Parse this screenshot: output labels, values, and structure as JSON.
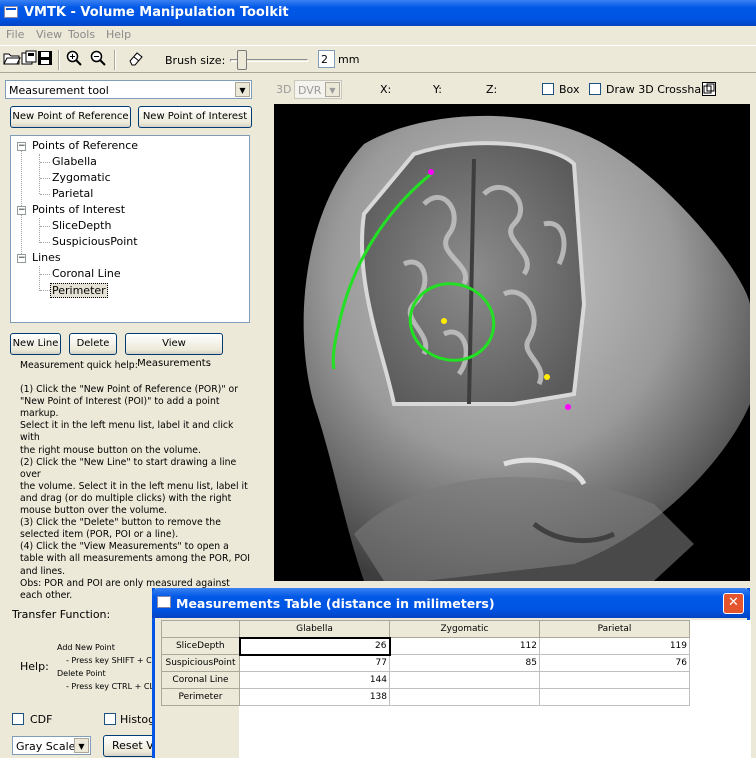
{
  "app": {
    "title": "VMTK - Volume Manipulation Toolkit"
  },
  "menu": [
    "File",
    "View",
    "Tools",
    "Help"
  ],
  "toolbar": {
    "brush_label": "Brush size:",
    "brush_value": "2",
    "brush_unit": "mm",
    "brush_slider_level": 0.1
  },
  "tool_select": {
    "selected": "Measurement tool"
  },
  "buttons": {
    "new_por": "New Point of Reference",
    "new_poi": "New Point of Interest",
    "new_line": "New Line",
    "delete": "Delete",
    "view_measurements": "View Measurements"
  },
  "tree": {
    "groups": [
      {
        "label": "Points of Reference",
        "items": [
          "Glabella",
          "Zygomatic",
          "Parietal"
        ]
      },
      {
        "label": "Points of Interest",
        "items": [
          "SliceDepth",
          "SuspiciousPoint"
        ]
      },
      {
        "label": "Lines",
        "items": [
          "Coronal Line",
          "Perimeter"
        ]
      }
    ],
    "selected": "Perimeter"
  },
  "help_text": {
    "title": "Measurement quick help:",
    "lines": [
      "(1) Click the \"New Point of Reference (POR)\" or",
      "\"New Point of Interest (POI)\" to add a point markup.",
      "Select it in the left menu list, label it and click with",
      "the right mouse button on the volume.",
      "(2) Click the \"New Line\" to start drawing a line over",
      "the volume. Select it in the left menu list, label it",
      "and drag (or do multiple clicks) with the right",
      "mouse button over the volume.",
      "(3) Click the \"Delete\" button to remove the",
      "selected item (POR, POI or a line).",
      "(4) Click the \"View Measurements\" to open a",
      "table with all measurements among the POR, POI",
      "and lines.",
      "Obs: POR and POI are only measured against",
      "each other."
    ]
  },
  "view_controls": {
    "mode_3d": "3D",
    "render_mode": "DVR",
    "x_label": "X:",
    "y_label": "Y:",
    "z_label": "Z:",
    "box_label": "Box",
    "crosshair_label": "Draw 3D Crosshair"
  },
  "lower_panel": {
    "transfer_function": "Transfer Function:",
    "help_label": "Help:",
    "help_lines": [
      "Add New Point",
      "- Press key SHIFT + CLIC",
      "Delete Point",
      "- Press key CTRL + CLIC"
    ],
    "cdf_label": "CDF",
    "histogram_label": "Histog",
    "colormap": "Gray Scale",
    "reset_label": "Reset Va"
  },
  "measurements_dialog": {
    "title": "Measurements Table (distance in milimeters)",
    "columns": [
      "Glabella",
      "Zygomatic",
      "Parietal"
    ],
    "rows": [
      {
        "label": "SliceDepth",
        "values": [
          "26",
          "112",
          "119"
        ]
      },
      {
        "label": "SuspiciousPoint",
        "values": [
          "77",
          "85",
          "76"
        ]
      },
      {
        "label": "Coronal Line",
        "values": [
          "144",
          "",
          ""
        ]
      },
      {
        "label": "Perimeter",
        "values": [
          "138",
          "",
          ""
        ]
      }
    ]
  },
  "colors": {
    "line_color": "#22e022",
    "poi_color": "#ff00ff",
    "por_color": "#ffee00",
    "title_blue": "#0054e3"
  }
}
